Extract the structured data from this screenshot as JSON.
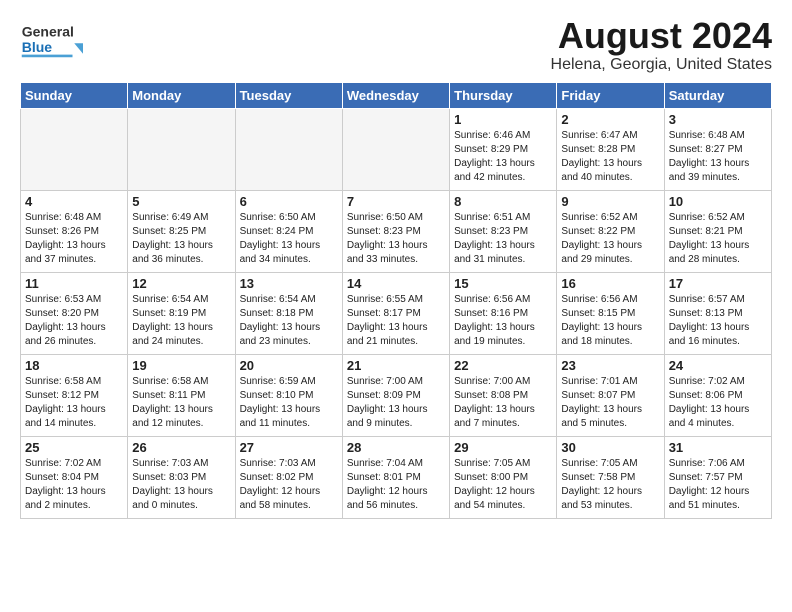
{
  "header": {
    "logo": {
      "line1": "General",
      "line2": "Blue"
    },
    "title": "August 2024",
    "subtitle": "Helena, Georgia, United States"
  },
  "days_of_week": [
    "Sunday",
    "Monday",
    "Tuesday",
    "Wednesday",
    "Thursday",
    "Friday",
    "Saturday"
  ],
  "weeks": [
    [
      {
        "day": "",
        "empty": true
      },
      {
        "day": "",
        "empty": true
      },
      {
        "day": "",
        "empty": true
      },
      {
        "day": "",
        "empty": true
      },
      {
        "day": "1",
        "sunrise": "6:46 AM",
        "sunset": "8:29 PM",
        "daylight": "13 hours and 42 minutes."
      },
      {
        "day": "2",
        "sunrise": "6:47 AM",
        "sunset": "8:28 PM",
        "daylight": "13 hours and 40 minutes."
      },
      {
        "day": "3",
        "sunrise": "6:48 AM",
        "sunset": "8:27 PM",
        "daylight": "13 hours and 39 minutes."
      }
    ],
    [
      {
        "day": "4",
        "sunrise": "6:48 AM",
        "sunset": "8:26 PM",
        "daylight": "13 hours and 37 minutes."
      },
      {
        "day": "5",
        "sunrise": "6:49 AM",
        "sunset": "8:25 PM",
        "daylight": "13 hours and 36 minutes."
      },
      {
        "day": "6",
        "sunrise": "6:50 AM",
        "sunset": "8:24 PM",
        "daylight": "13 hours and 34 minutes."
      },
      {
        "day": "7",
        "sunrise": "6:50 AM",
        "sunset": "8:23 PM",
        "daylight": "13 hours and 33 minutes."
      },
      {
        "day": "8",
        "sunrise": "6:51 AM",
        "sunset": "8:23 PM",
        "daylight": "13 hours and 31 minutes."
      },
      {
        "day": "9",
        "sunrise": "6:52 AM",
        "sunset": "8:22 PM",
        "daylight": "13 hours and 29 minutes."
      },
      {
        "day": "10",
        "sunrise": "6:52 AM",
        "sunset": "8:21 PM",
        "daylight": "13 hours and 28 minutes."
      }
    ],
    [
      {
        "day": "11",
        "sunrise": "6:53 AM",
        "sunset": "8:20 PM",
        "daylight": "13 hours and 26 minutes."
      },
      {
        "day": "12",
        "sunrise": "6:54 AM",
        "sunset": "8:19 PM",
        "daylight": "13 hours and 24 minutes."
      },
      {
        "day": "13",
        "sunrise": "6:54 AM",
        "sunset": "8:18 PM",
        "daylight": "13 hours and 23 minutes."
      },
      {
        "day": "14",
        "sunrise": "6:55 AM",
        "sunset": "8:17 PM",
        "daylight": "13 hours and 21 minutes."
      },
      {
        "day": "15",
        "sunrise": "6:56 AM",
        "sunset": "8:16 PM",
        "daylight": "13 hours and 19 minutes."
      },
      {
        "day": "16",
        "sunrise": "6:56 AM",
        "sunset": "8:15 PM",
        "daylight": "13 hours and 18 minutes."
      },
      {
        "day": "17",
        "sunrise": "6:57 AM",
        "sunset": "8:13 PM",
        "daylight": "13 hours and 16 minutes."
      }
    ],
    [
      {
        "day": "18",
        "sunrise": "6:58 AM",
        "sunset": "8:12 PM",
        "daylight": "13 hours and 14 minutes."
      },
      {
        "day": "19",
        "sunrise": "6:58 AM",
        "sunset": "8:11 PM",
        "daylight": "13 hours and 12 minutes."
      },
      {
        "day": "20",
        "sunrise": "6:59 AM",
        "sunset": "8:10 PM",
        "daylight": "13 hours and 11 minutes."
      },
      {
        "day": "21",
        "sunrise": "7:00 AM",
        "sunset": "8:09 PM",
        "daylight": "13 hours and 9 minutes."
      },
      {
        "day": "22",
        "sunrise": "7:00 AM",
        "sunset": "8:08 PM",
        "daylight": "13 hours and 7 minutes."
      },
      {
        "day": "23",
        "sunrise": "7:01 AM",
        "sunset": "8:07 PM",
        "daylight": "13 hours and 5 minutes."
      },
      {
        "day": "24",
        "sunrise": "7:02 AM",
        "sunset": "8:06 PM",
        "daylight": "13 hours and 4 minutes."
      }
    ],
    [
      {
        "day": "25",
        "sunrise": "7:02 AM",
        "sunset": "8:04 PM",
        "daylight": "13 hours and 2 minutes."
      },
      {
        "day": "26",
        "sunrise": "7:03 AM",
        "sunset": "8:03 PM",
        "daylight": "13 hours and 0 minutes."
      },
      {
        "day": "27",
        "sunrise": "7:03 AM",
        "sunset": "8:02 PM",
        "daylight": "12 hours and 58 minutes."
      },
      {
        "day": "28",
        "sunrise": "7:04 AM",
        "sunset": "8:01 PM",
        "daylight": "12 hours and 56 minutes."
      },
      {
        "day": "29",
        "sunrise": "7:05 AM",
        "sunset": "8:00 PM",
        "daylight": "12 hours and 54 minutes."
      },
      {
        "day": "30",
        "sunrise": "7:05 AM",
        "sunset": "7:58 PM",
        "daylight": "12 hours and 53 minutes."
      },
      {
        "day": "31",
        "sunrise": "7:06 AM",
        "sunset": "7:57 PM",
        "daylight": "12 hours and 51 minutes."
      }
    ]
  ]
}
